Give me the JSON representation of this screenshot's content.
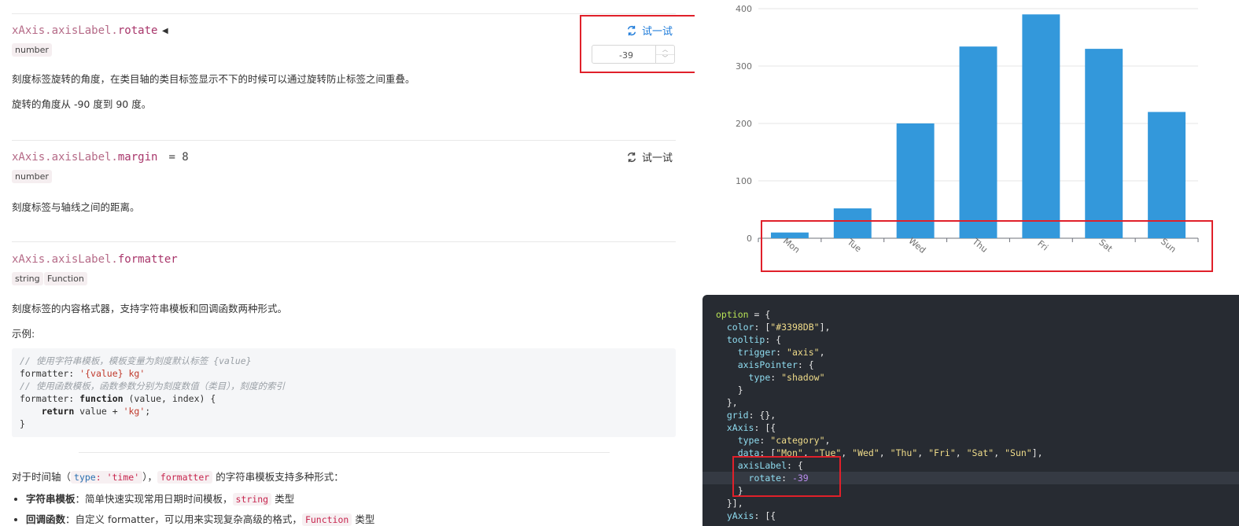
{
  "doc": {
    "rotate": {
      "path": "xAxis.axisLabel.",
      "name": "rotate",
      "type_tag": "number",
      "try_label": "试一试",
      "stepper_value": "-39",
      "desc1": "刻度标签旋转的角度，在类目轴的类目标签显示不下的时候可以通过旋转防止标签之间重叠。",
      "desc2": "旋转的角度从 -90 度到 90 度。"
    },
    "margin": {
      "path": "xAxis.axisLabel.",
      "name": "margin",
      "default": "= 8",
      "type_tag": "number",
      "try_label": "试一试",
      "desc": "刻度标签与轴线之间的距离。"
    },
    "formatter": {
      "path": "xAxis.axisLabel.",
      "name": "formatter",
      "type_tags": [
        "string",
        "Function"
      ],
      "desc": "刻度标签的内容格式器，支持字符串模板和回调函数两种形式。",
      "example_label": "示例:",
      "code": {
        "comment1": "// 使用字符串模板，模板变量为刻度默认标签 {value}",
        "line2_key": "formatter: ",
        "line2_str": "'{value} kg'",
        "comment3": "// 使用函数模板，函数参数分别为刻度数值（类目），刻度的索引",
        "line4_key": "formatter: ",
        "line4_kw": "function",
        "line4_rest": " (value, index) {",
        "line5_kw": "return",
        "line5_rest": " value + ",
        "line5_str": "'kg'",
        "line5_end": ";",
        "line6": "}"
      },
      "time_axis_pre": "对于时间轴（",
      "time_axis_code_key": "type",
      "time_axis_code_colon": ": ",
      "time_axis_code_val": "'time'",
      "time_axis_mid": "），",
      "time_axis_code2": "formatter",
      "time_axis_post": "的字符串模板支持多种形式：",
      "bullets": [
        {
          "bold": "字符串模板",
          "text": "：简单快速实现常用日期时间模板，",
          "code": "string",
          "end": "类型"
        },
        {
          "bold": "回调函数",
          "text": "：自定义 formatter，可以用来实现复杂高级的格式，",
          "code": "Function",
          "end": "类型"
        }
      ]
    }
  },
  "colors": {
    "bar": "#3398DB",
    "highlight_box": "#e0202a",
    "try_active": "#1a79d9"
  },
  "chart_data": {
    "type": "bar",
    "categories": [
      "Mon",
      "Tue",
      "Wed",
      "Thu",
      "Fri",
      "Sat",
      "Sun"
    ],
    "values": [
      10,
      52,
      200,
      334,
      390,
      330,
      220
    ],
    "ylim": [
      0,
      400
    ],
    "yticks": [
      0,
      100,
      200,
      300,
      400
    ],
    "label_rotate": -39,
    "grid": true,
    "color": "#3398DB"
  },
  "editor": {
    "lines": [
      [
        [
          "e-var",
          "option"
        ],
        [
          "e-p",
          " = {"
        ]
      ],
      [
        [
          "e-p",
          "  "
        ],
        [
          "e-key",
          "color"
        ],
        [
          "e-p",
          ": ["
        ],
        [
          "e-str",
          "\"#3398DB\""
        ],
        [
          "e-p",
          "],"
        ]
      ],
      [
        [
          "e-p",
          "  "
        ],
        [
          "e-key",
          "tooltip"
        ],
        [
          "e-p",
          ": {"
        ]
      ],
      [
        [
          "e-p",
          "    "
        ],
        [
          "e-key",
          "trigger"
        ],
        [
          "e-p",
          ": "
        ],
        [
          "e-str",
          "\"axis\""
        ],
        [
          "e-p",
          ","
        ]
      ],
      [
        [
          "e-p",
          "    "
        ],
        [
          "e-key",
          "axisPointer"
        ],
        [
          "e-p",
          ": {"
        ]
      ],
      [
        [
          "e-p",
          "      "
        ],
        [
          "e-key",
          "type"
        ],
        [
          "e-p",
          ": "
        ],
        [
          "e-str",
          "\"shadow\""
        ]
      ],
      [
        [
          "e-p",
          "    }"
        ]
      ],
      [
        [
          "e-p",
          "  },"
        ]
      ],
      [
        [
          "e-p",
          "  "
        ],
        [
          "e-key",
          "grid"
        ],
        [
          "e-p",
          ": {},"
        ]
      ],
      [
        [
          "e-p",
          "  "
        ],
        [
          "e-key",
          "xAxis"
        ],
        [
          "e-p",
          ": [{"
        ]
      ],
      [
        [
          "e-p",
          "    "
        ],
        [
          "e-key",
          "type"
        ],
        [
          "e-p",
          ": "
        ],
        [
          "e-str",
          "\"category\""
        ],
        [
          "e-p",
          ","
        ]
      ],
      [
        [
          "e-p",
          "    "
        ],
        [
          "e-key",
          "data"
        ],
        [
          "e-p",
          ": ["
        ],
        [
          "e-str",
          "\"Mon\""
        ],
        [
          "e-p",
          ", "
        ],
        [
          "e-str",
          "\"Tue\""
        ],
        [
          "e-p",
          ", "
        ],
        [
          "e-str",
          "\"Wed\""
        ],
        [
          "e-p",
          ", "
        ],
        [
          "e-str",
          "\"Thu\""
        ],
        [
          "e-p",
          ", "
        ],
        [
          "e-str",
          "\"Fri\""
        ],
        [
          "e-p",
          ", "
        ],
        [
          "e-str",
          "\"Sat\""
        ],
        [
          "e-p",
          ", "
        ],
        [
          "e-str",
          "\"Sun\""
        ],
        [
          "e-p",
          "],"
        ]
      ],
      [
        [
          "e-p",
          "    "
        ],
        [
          "e-key",
          "axisLabel"
        ],
        [
          "e-p",
          ": {"
        ]
      ],
      [
        [
          "e-p",
          "      "
        ],
        [
          "e-key",
          "rotate"
        ],
        [
          "e-p",
          ": "
        ],
        [
          "e-num",
          "-39"
        ]
      ],
      [
        [
          "e-p",
          "    }"
        ]
      ],
      [
        [
          "e-p",
          "  }],"
        ]
      ],
      [
        [
          "e-p",
          "  "
        ],
        [
          "e-key",
          "yAxis"
        ],
        [
          "e-p",
          ": [{"
        ]
      ]
    ],
    "highlight_line": 13
  }
}
